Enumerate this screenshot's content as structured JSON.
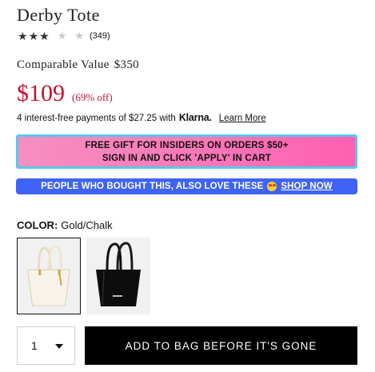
{
  "product": {
    "title": "Derby Tote",
    "rating": {
      "stars_filled": 3,
      "stars_total": 5,
      "reviews_text": "(349)"
    },
    "comparable_label": "Comparable Value",
    "comparable_value": "$350",
    "price": "$109",
    "discount": "(69% off)"
  },
  "klarna": {
    "text": "4 interest-free payments of $27.25 with",
    "brand": "Klarna.",
    "learn_more": "Learn More"
  },
  "promo": {
    "line1": "FREE GIFT FOR INSIDERS ON ORDERS $50+",
    "line2": "SIGN IN AND CLICK 'APPLY' IN CART",
    "bg_start": "#f58fc0",
    "bg_end": "#ff5fb2",
    "border_color": "#58c7ee"
  },
  "people_banner": {
    "text": "PEOPLE WHO BOUGHT THIS, ALSO LOVE THESE",
    "emoji": "heart-eyes-emoji",
    "link": "SHOP NOW",
    "bg": "#3f63f5"
  },
  "color": {
    "label": "COLOR:",
    "selected": "Gold/Chalk",
    "swatches": [
      {
        "name": "Gold/Chalk",
        "color": "#efeadc",
        "selected": true
      },
      {
        "name": "Black",
        "color": "#111111",
        "selected": false
      }
    ]
  },
  "purchase": {
    "quantity": "1",
    "add_to_bag": "ADD TO BAG BEFORE IT'S GONE"
  },
  "colors": {
    "price_red": "#c8102e"
  }
}
